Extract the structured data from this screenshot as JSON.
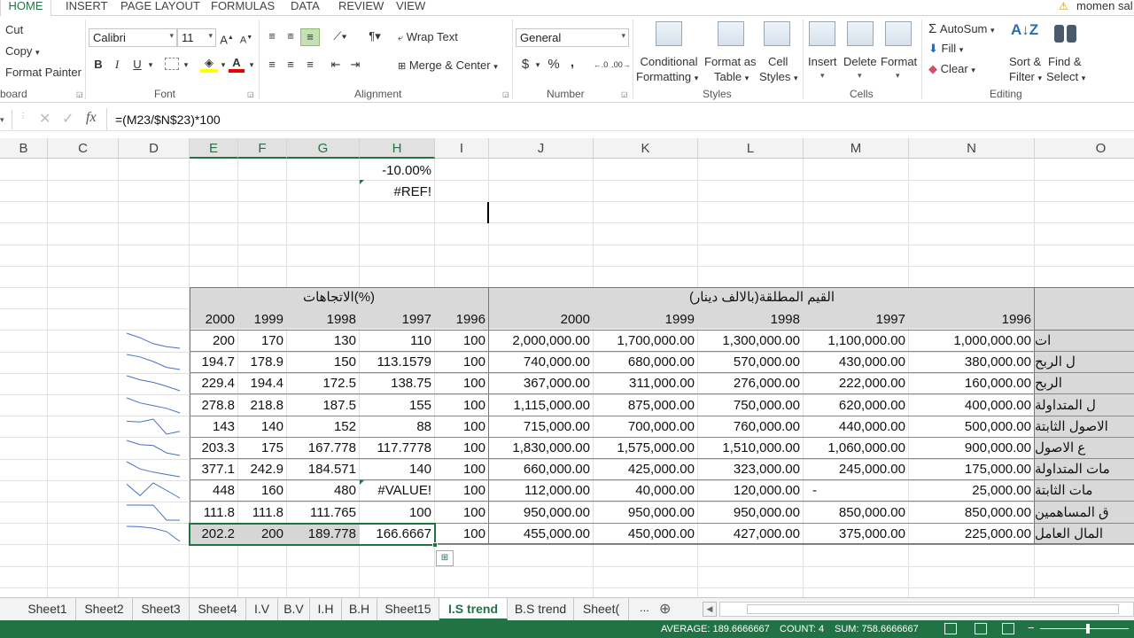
{
  "ribbon_tabs": [
    "HOME",
    "INSERT",
    "PAGE LAYOUT",
    "FORMULAS",
    "DATA",
    "REVIEW",
    "VIEW"
  ],
  "user_name": "momen sal",
  "clipboard": {
    "cut": "Cut",
    "copy": "Copy",
    "format_painter": "Format Painter",
    "label": "board"
  },
  "font": {
    "name": "Calibri",
    "size": "11",
    "label": "Font"
  },
  "alignment": {
    "wrap": "Wrap Text",
    "merge": "Merge & Center",
    "label": "Alignment"
  },
  "number": {
    "format": "General",
    "label": "Number",
    "currency": "$",
    "percent": "%",
    "comma": ","
  },
  "styles": {
    "conditional": [
      "Conditional",
      "Formatting"
    ],
    "format_table": [
      "Format as",
      "Table"
    ],
    "cell_styles": [
      "Cell",
      "Styles"
    ],
    "label": "Styles"
  },
  "cells": {
    "insert": "Insert",
    "delete": "Delete",
    "format": "Format",
    "label": "Cells"
  },
  "editing": {
    "autosum": "AutoSum",
    "fill": "Fill",
    "clear": "Clear",
    "sort": [
      "Sort &",
      "Filter"
    ],
    "find": [
      "Find &",
      "Select"
    ],
    "label": "Editing"
  },
  "formula": {
    "text": "=(M23/$N$23)*100"
  },
  "columns": [
    "B",
    "C",
    "D",
    "E",
    "F",
    "G",
    "H",
    "I",
    "J",
    "K",
    "L",
    "M",
    "N",
    "O"
  ],
  "top_cells": {
    "h1": "-10.00%",
    "h2": "#REF!"
  },
  "headers": {
    "trends": "الاتجاهات(%)",
    "absolute": "القيم المطلقة(بالالف دينار)"
  },
  "years_pct": [
    "2000",
    "1999",
    "1998",
    "1997",
    "1996"
  ],
  "years_abs": [
    "2000",
    "1999",
    "1998",
    "1997",
    "1996"
  ],
  "rows": [
    {
      "pct": [
        "200",
        "170",
        "130",
        "110",
        "100"
      ],
      "abs": [
        "2,000,000.00",
        "1,700,000.00",
        "1,300,000.00",
        "1,100,000.00",
        "1,000,000.00"
      ],
      "label": "ات"
    },
    {
      "pct": [
        "194.7",
        "178.9",
        "150",
        "113.1579",
        "100"
      ],
      "abs": [
        "740,000.00",
        "680,000.00",
        "570,000.00",
        "430,000.00",
        "380,000.00"
      ],
      "label": "ل الربح"
    },
    {
      "pct": [
        "229.4",
        "194.4",
        "172.5",
        "138.75",
        "100"
      ],
      "abs": [
        "367,000.00",
        "311,000.00",
        "276,000.00",
        "222,000.00",
        "160,000.00"
      ],
      "label": "الربح"
    },
    {
      "pct": [
        "278.8",
        "218.8",
        "187.5",
        "155",
        "100"
      ],
      "abs": [
        "1,115,000.00",
        "875,000.00",
        "750,000.00",
        "620,000.00",
        "400,000.00"
      ],
      "label": "ل المتداولة"
    },
    {
      "pct": [
        "143",
        "140",
        "152",
        "88",
        "100"
      ],
      "abs": [
        "715,000.00",
        "700,000.00",
        "760,000.00",
        "440,000.00",
        "500,000.00"
      ],
      "label": "الاصول الثابتة"
    },
    {
      "pct": [
        "203.3",
        "175",
        "167.778",
        "117.7778",
        "100"
      ],
      "abs": [
        "1,830,000.00",
        "1,575,000.00",
        "1,510,000.00",
        "1,060,000.00",
        "900,000.00"
      ],
      "label": "ع الاصول"
    },
    {
      "pct": [
        "377.1",
        "242.9",
        "184.571",
        "140",
        "100"
      ],
      "abs": [
        "660,000.00",
        "425,000.00",
        "323,000.00",
        "245,000.00",
        "175,000.00"
      ],
      "label": "مات المتداولة"
    },
    {
      "pct": [
        "448",
        "160",
        "480",
        "#VALUE!",
        "100"
      ],
      "abs": [
        "112,000.00",
        "40,000.00",
        "120,000.00",
        "-",
        "25,000.00"
      ],
      "label": "مات الثابتة"
    },
    {
      "pct": [
        "111.8",
        "111.8",
        "111.765",
        "100",
        "100"
      ],
      "abs": [
        "950,000.00",
        "950,000.00",
        "950,000.00",
        "850,000.00",
        "850,000.00"
      ],
      "label": "ق المساهمين"
    },
    {
      "pct": [
        "202.2",
        "200",
        "189.778",
        "166.6667",
        "100"
      ],
      "abs": [
        "455,000.00",
        "450,000.00",
        "427,000.00",
        "375,000.00",
        "225,000.00"
      ],
      "label": "المال العامل"
    }
  ],
  "sheets": [
    "Sheet1",
    "Sheet2",
    "Sheet3",
    "Sheet4",
    "I.V",
    "B.V",
    "I.H",
    "B.H",
    "Sheet15",
    "I.S trend",
    "B.S trend",
    "Sheet("
  ],
  "active_sheet": "I.S trend",
  "status": {
    "average": "AVERAGE: 189.6666667",
    "count": "COUNT: 4",
    "sum": "SUM: 758.6666667"
  }
}
